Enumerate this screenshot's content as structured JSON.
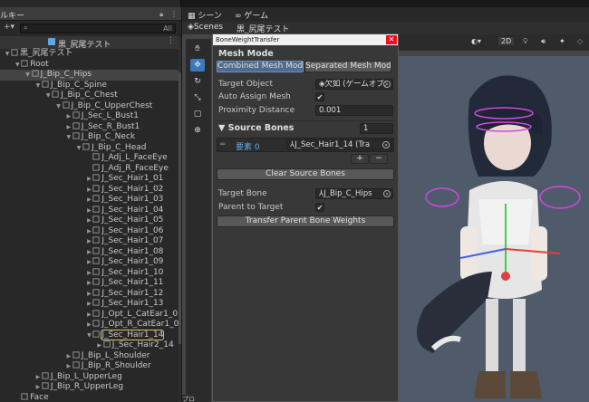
{
  "hierarchy": {
    "tab_label": "ルキー",
    "search_all": "All",
    "scene_name": "黒_尻尾テスト",
    "items": [
      {
        "label": "黒_尻尾テスト",
        "depth": 0,
        "arrow": "▼",
        "type": "obj"
      },
      {
        "label": "Root",
        "depth": 1,
        "arrow": "▼",
        "type": "obj"
      },
      {
        "label": "J_Bip_C_Hips",
        "depth": 2,
        "arrow": "▼",
        "type": "obj",
        "state": "selected"
      },
      {
        "label": "J_Bip_C_Spine",
        "depth": 3,
        "arrow": "▼",
        "type": "obj"
      },
      {
        "label": "J_Bip_C_Chest",
        "depth": 4,
        "arrow": "▼",
        "type": "obj"
      },
      {
        "label": "J_Bip_C_UpperChest",
        "depth": 5,
        "arrow": "▼",
        "type": "obj"
      },
      {
        "label": "J_Sec_L_Bust1",
        "depth": 6,
        "arrow": "▶",
        "type": "obj"
      },
      {
        "label": "J_Sec_R_Bust1",
        "depth": 6,
        "arrow": "▶",
        "type": "obj"
      },
      {
        "label": "J_Bip_C_Neck",
        "depth": 6,
        "arrow": "▼",
        "type": "obj"
      },
      {
        "label": "J_Bip_C_Head",
        "depth": 7,
        "arrow": "▼",
        "type": "obj"
      },
      {
        "label": "J_Adj_L_FaceEye",
        "depth": 8,
        "arrow": "",
        "type": "obj"
      },
      {
        "label": "J_Adj_R_FaceEye",
        "depth": 8,
        "arrow": "",
        "type": "obj"
      },
      {
        "label": "J_Sec_Hair1_01",
        "depth": 8,
        "arrow": "▶",
        "type": "obj"
      },
      {
        "label": "J_Sec_Hair1_02",
        "depth": 8,
        "arrow": "▶",
        "type": "obj"
      },
      {
        "label": "J_Sec_Hair1_03",
        "depth": 8,
        "arrow": "▶",
        "type": "obj"
      },
      {
        "label": "J_Sec_Hair1_04",
        "depth": 8,
        "arrow": "▶",
        "type": "obj"
      },
      {
        "label": "J_Sec_Hair1_05",
        "depth": 8,
        "arrow": "▶",
        "type": "obj"
      },
      {
        "label": "J_Sec_Hair1_06",
        "depth": 8,
        "arrow": "▶",
        "type": "obj"
      },
      {
        "label": "J_Sec_Hair1_07",
        "depth": 8,
        "arrow": "▶",
        "type": "obj"
      },
      {
        "label": "J_Sec_Hair1_08",
        "depth": 8,
        "arrow": "▶",
        "type": "obj"
      },
      {
        "label": "J_Sec_Hair1_09",
        "depth": 8,
        "arrow": "▶",
        "type": "obj"
      },
      {
        "label": "J_Sec_Hair1_10",
        "depth": 8,
        "arrow": "▶",
        "type": "obj"
      },
      {
        "label": "J_Sec_Hair1_11",
        "depth": 8,
        "arrow": "▶",
        "type": "obj"
      },
      {
        "label": "J_Sec_Hair1_12",
        "depth": 8,
        "arrow": "▶",
        "type": "obj"
      },
      {
        "label": "J_Sec_Hair1_13",
        "depth": 8,
        "arrow": "▶",
        "type": "obj"
      },
      {
        "label": "J_Opt_L_CatEar1_0",
        "depth": 8,
        "arrow": "▶",
        "type": "obj"
      },
      {
        "label": "J_Opt_R_CatEar1_0",
        "depth": 8,
        "arrow": "▶",
        "type": "obj"
      },
      {
        "label": "J_Sec_Hair1_14",
        "depth": 8,
        "arrow": "▼",
        "type": "obj",
        "state": "highlighted"
      },
      {
        "label": "J_Sec_Hair2_14",
        "depth": 9,
        "arrow": "▶",
        "type": "obj"
      },
      {
        "label": "J_Bip_L_Shoulder",
        "depth": 6,
        "arrow": "▶",
        "type": "obj"
      },
      {
        "label": "J_Bip_R_Shoulder",
        "depth": 6,
        "arrow": "▶",
        "type": "obj"
      },
      {
        "label": "J_Bip_L_UpperLeg",
        "depth": 3,
        "arrow": "▶",
        "type": "obj"
      },
      {
        "label": "J_Bip_R_UpperLeg",
        "depth": 3,
        "arrow": "▶",
        "type": "obj"
      },
      {
        "label": "Face",
        "depth": 1,
        "arrow": "",
        "type": "obj"
      }
    ]
  },
  "scene": {
    "tab_scene": "シーン",
    "tab_game": "ゲーム",
    "scenes_label": "Scenes",
    "scene_name": "黒_尻尾テスト",
    "btn_2d": "2D",
    "bottom_tab": "プロ"
  },
  "window": {
    "title": "BoneWeightTransfer",
    "close": "✕",
    "mesh_mode_title": "Mesh Mode",
    "combined_btn": "Combined Mesh Mode",
    "separated_btn": "Separated Mesh Mode",
    "target_object_label": "Target Object",
    "target_object_value": "欠如 (ゲームオブ:",
    "auto_assign_label": "Auto Assign Mesh",
    "auto_assign_check": "✔",
    "proximity_label": "Proximity Distance",
    "proximity_value": "0.001",
    "source_bones_title": "Source Bones",
    "source_bones_count": "1",
    "element_label": "要素 0",
    "element_value": "J_Sec_Hair1_14 (Tra",
    "plus_btn": "+",
    "minus_btn": "−",
    "clear_btn": "Clear Source Bones",
    "target_bone_label": "Target Bone",
    "target_bone_value": "J_Bip_C_Hips",
    "parent_label": "Parent to Target",
    "parent_check": "✔",
    "transfer_btn": "Transfer Parent Bone Weights"
  },
  "colors": {
    "accent": "#3a79bb",
    "highlight_outline": "#d5c36a",
    "close": "#e81123"
  }
}
